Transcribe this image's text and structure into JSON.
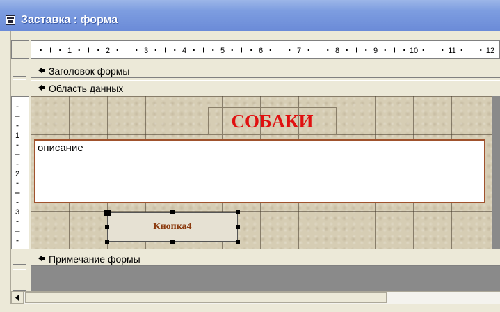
{
  "window": {
    "title": "Заставка : форма",
    "icon": "form-icon"
  },
  "ruler": {
    "marks": [
      "1",
      "2",
      "3",
      "4",
      "5",
      "6",
      "7",
      "8",
      "9",
      "10",
      "11",
      "12"
    ],
    "vertical_marks": [
      "1",
      "2",
      "3"
    ]
  },
  "sections": {
    "header": "Заголовок формы",
    "detail": "Область данных",
    "footer": "Примечание формы"
  },
  "controls": {
    "title_label": "СОБАКИ",
    "description_field": "описание",
    "button": "Кнопка4"
  },
  "colors": {
    "title_text": "#e01010",
    "button_text": "#8b3a0e",
    "textbox_border": "#a0522d",
    "titlebar": "#7d9de0"
  }
}
